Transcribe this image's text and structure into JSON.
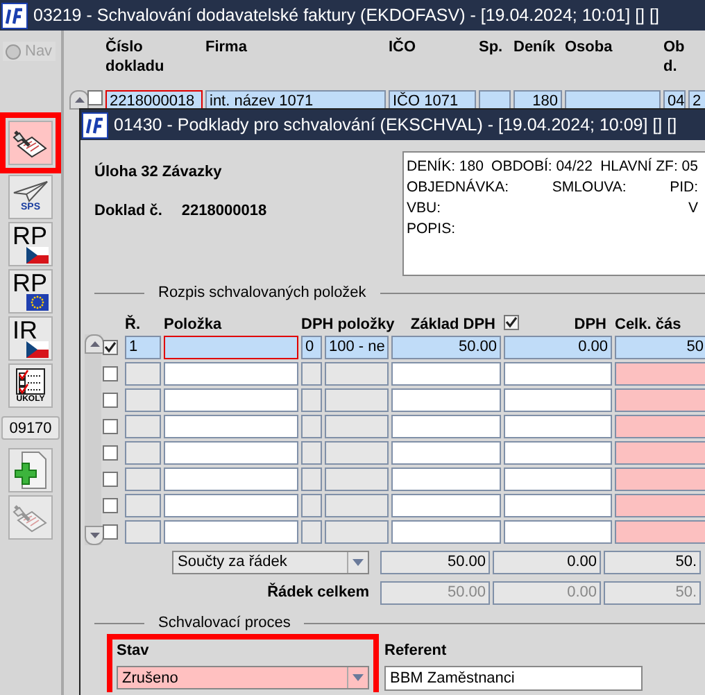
{
  "main_window": {
    "title": "03219 - Schvalování dodavatelské faktury (EKDOFASV) - [19.04.2024; 10:01] [] []",
    "nav": {
      "label": "Nav",
      "disabled": true
    },
    "toolbar": [
      {
        "kind": "pen-paper",
        "highlighted": true
      },
      {
        "kind": "plane",
        "label": "SPS",
        "highlighted": false
      },
      {
        "kind": "flag-cz",
        "label": "RP",
        "highlighted": false
      },
      {
        "kind": "flag-eu",
        "label": "RP",
        "highlighted": false
      },
      {
        "kind": "flag-cz",
        "label": "IR",
        "highlighted": false
      },
      {
        "kind": "tasks",
        "label": "ÚKOLY",
        "highlighted": false
      },
      {
        "kind": "code",
        "label": "09170"
      },
      {
        "kind": "add-document",
        "highlighted": false
      },
      {
        "kind": "pen-paper-disabled",
        "highlighted": false
      }
    ],
    "table": {
      "columns": [
        "Číslo dokladu",
        "Firma",
        "IČO",
        "Sp.",
        "Deník",
        "Osoba",
        "Ob d."
      ],
      "rows": [
        {
          "checked": false,
          "cells": [
            "2218000018",
            "int. název 1071",
            "IČO 1071",
            "",
            "180",
            "",
            "04",
            "2"
          ]
        }
      ]
    }
  },
  "dialog": {
    "title": "01430 - Podklady pro schvalování (EKSCHVAL) - [19.04.2024; 10:09] [] []",
    "task": "Úloha 32 Závazky",
    "doc_label": "Doklad č.",
    "doc_number": "2218000018",
    "info_lines": [
      [
        "DENÍK: 180",
        "OBDOBÍ: 04/22",
        "HLAVNÍ ZF: 05"
      ],
      [
        "OBJEDNÁVKA:",
        "SMLOUVA:",
        "PID:"
      ],
      [
        "VBU:",
        "V"
      ],
      [
        "POPIS:"
      ]
    ],
    "items_section": "Rozpis schvalovaných položek",
    "columns": [
      {
        "label": "Ř."
      },
      {
        "label": "Položka"
      },
      {
        "label": "DPH položky"
      },
      {
        "label": "Základ DPH"
      },
      {
        "label": "DPH",
        "checked": true
      },
      {
        "label": "Celk. čás"
      }
    ],
    "rows": [
      {
        "checked": true,
        "selected": true,
        "cells": [
          "1",
          "",
          "0",
          "100 - ne",
          "50.00",
          "0.00",
          "50."
        ]
      },
      {
        "checked": false,
        "selected": false
      },
      {
        "checked": false,
        "selected": false
      },
      {
        "checked": false,
        "selected": false
      },
      {
        "checked": false,
        "selected": false
      },
      {
        "checked": false,
        "selected": false
      },
      {
        "checked": false,
        "selected": false
      },
      {
        "checked": false,
        "selected": false
      }
    ],
    "totals_select": "Součty za řádek",
    "totals": [
      "50.00",
      "0.00",
      "50."
    ],
    "row_total_label": "Řádek celkem",
    "row_totals": [
      "50.00",
      "0.00",
      "50."
    ],
    "process_section": "Schvalovací proces",
    "status": {
      "label": "Stav",
      "value": "Zrušeno",
      "highlighted": true
    },
    "referent": {
      "label": "Referent",
      "value": "BBM Zaměstnanci"
    }
  }
}
